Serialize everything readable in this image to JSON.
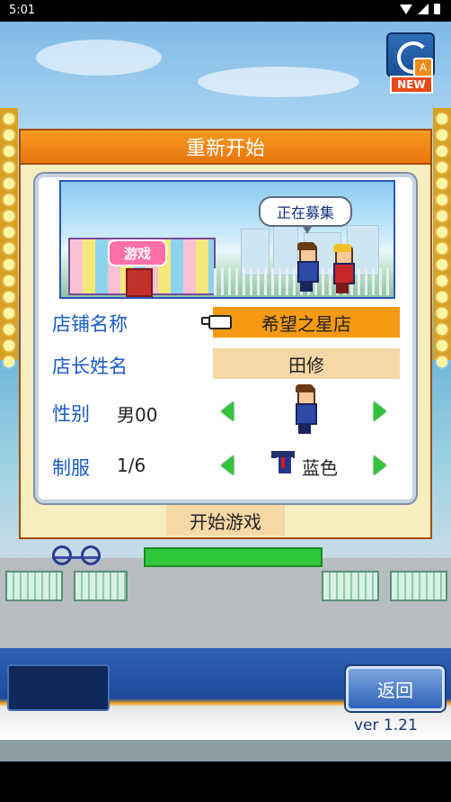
{
  "status_bar": {
    "time": "5:01"
  },
  "top_right_button": {
    "badge_letter": "A",
    "tag": "NEW"
  },
  "dialog": {
    "title": "重新开始",
    "scene": {
      "shop_sign": "游戏",
      "speech_bubble": "正在募集"
    },
    "store_name": {
      "label": "店铺名称",
      "value": "希望之星店"
    },
    "manager_name": {
      "label": "店长姓名",
      "value": "田修"
    },
    "gender": {
      "label": "性别",
      "value": "男00"
    },
    "uniform": {
      "label": "制服",
      "count": "1/6",
      "color_name": "蓝色"
    },
    "start_button": "开始游戏"
  },
  "footer": {
    "back_button": "返回",
    "version": "ver 1.21"
  },
  "colors": {
    "title_orange": "#f08a15",
    "label_blue": "#1a5bc4",
    "arrow_green": "#2fc43a",
    "field_orange": "#f59a12",
    "field_beige": "#f6d7a6"
  }
}
